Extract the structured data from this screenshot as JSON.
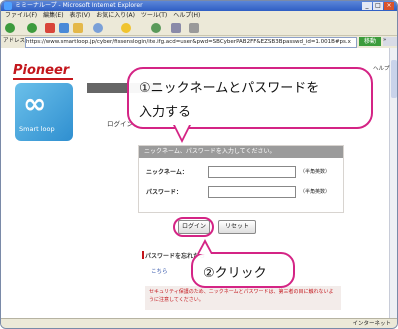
{
  "window": {
    "title": "ミミーナループ - Microsoft Internet Explorer",
    "controls": [
      "_",
      "□",
      "×"
    ]
  },
  "menubar": [
    "ファイル(F)",
    "編集(E)",
    "表示(V)",
    "お気に入り(A)",
    "ツール(T)",
    "ヘルプ(H)"
  ],
  "toolbar": {
    "icons": [
      "back-icon",
      "forward-icon",
      "stop-icon",
      "refresh-icon",
      "home-icon",
      "search-icon",
      "favorites-icon",
      "history-icon",
      "mail-icon",
      "print-icon"
    ]
  },
  "address": {
    "label": "アドレス(D)",
    "url": "https://www.smartloop.jp/cyber/fissenslogin/ite.ifg.acd=user&pwd=SBCyberPAB2FF&EZSB3Bpasswd_id=1.001B#ps.x",
    "go_label": "移動",
    "links_label": "»"
  },
  "page": {
    "brand": "Pioneer",
    "service_name": "Smart loop",
    "gray_bar": "",
    "login_heading": "ログイン",
    "topright_text": "ヘルプ",
    "form": {
      "header": "ニックネーム、パスワードを入力してください。",
      "nickname_label": "ニックネーム：",
      "nickname_note": "（半角英数）",
      "password_label": "パスワード：",
      "password_note": "（半角英数）"
    },
    "login_button": "ログイン",
    "reset_button": "リセット",
    "forgot_heading": "パスワードを忘れたら",
    "forgot_link": "こちら",
    "warning": "セキュリティ保護のため、ニックネームとパスワードは、第三者の目に触れないように注意してください。"
  },
  "statusbar": {
    "zone": "インターネット"
  },
  "callouts": {
    "step1_line1": "①ニックネームとパスワードを",
    "step1_line2": "入力する",
    "step2": "②クリック"
  },
  "colors": {
    "accent": "#d42485",
    "brand": "#c3161c",
    "logo_blue": "#2f8fd0"
  }
}
